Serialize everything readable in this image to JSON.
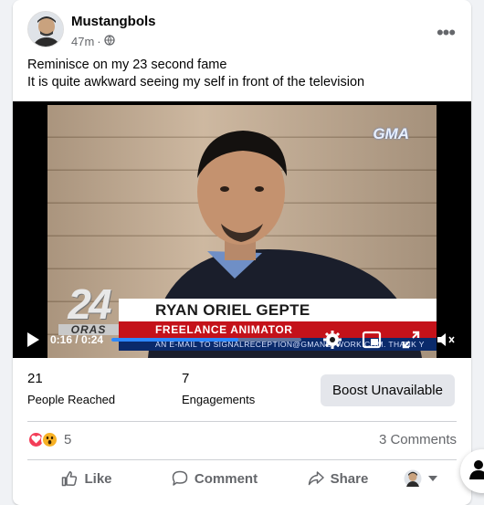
{
  "post": {
    "author": "Mustangbols",
    "time": "47m",
    "audience_icon": "globe-icon",
    "caption_lines": [
      "Reminisce on my 23 second fame",
      "It is quite awkward seeing my self in front of the television"
    ]
  },
  "video": {
    "channel_logo": "GMA",
    "show_number": "24",
    "show_word": "ORAS",
    "lower_third_name": "RYAN ORIEL GEPTE",
    "lower_third_title": "FREELANCE ANIMATOR",
    "ticker": "AN E-MAIL TO SIGNALRECEPTION@GMANETWORK.COM. THANK Y",
    "time_display": "0:16 / 0:24",
    "progress_fraction": 0.6667,
    "controls": [
      "play-icon",
      "settings-gear-icon",
      "picture-in-picture-icon",
      "fullscreen-icon",
      "volume-muted-icon"
    ],
    "colors": {
      "progress": "#2d88ff",
      "ticker_bg": "#0a2a6b",
      "title_bg": "#c4121a"
    }
  },
  "stats": {
    "people_reached_value": "21",
    "people_reached_label": "People Reached",
    "engagements_value": "7",
    "engagements_label": "Engagements",
    "boost_label": "Boost Unavailable"
  },
  "reactions": {
    "icons": [
      "love-reaction-icon",
      "wow-reaction-icon"
    ],
    "count": "5",
    "comments": "3 Comments"
  },
  "actions": {
    "like": "Like",
    "comment": "Comment",
    "share": "Share"
  }
}
